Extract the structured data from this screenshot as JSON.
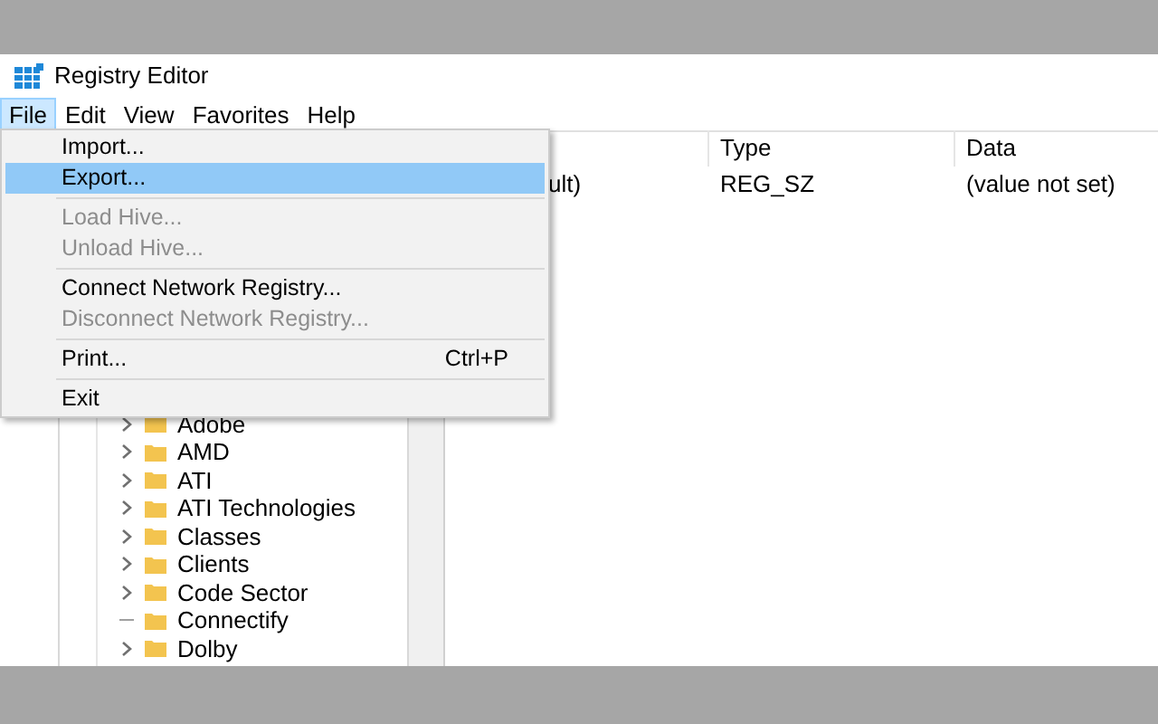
{
  "window": {
    "title": "Registry Editor"
  },
  "menu_bar": [
    {
      "label": "File",
      "selected": true
    },
    {
      "label": "Edit",
      "selected": false
    },
    {
      "label": "View",
      "selected": false
    },
    {
      "label": "Favorites",
      "selected": false
    },
    {
      "label": "Help",
      "selected": false
    }
  ],
  "file_menu": [
    {
      "kind": "item",
      "label": "Import...",
      "selected": false,
      "disabled": false
    },
    {
      "kind": "item",
      "label": "Export...",
      "selected": true,
      "disabled": false
    },
    {
      "kind": "separator"
    },
    {
      "kind": "item",
      "label": "Load Hive...",
      "selected": false,
      "disabled": true
    },
    {
      "kind": "item",
      "label": "Unload Hive...",
      "selected": false,
      "disabled": true
    },
    {
      "kind": "separator"
    },
    {
      "kind": "item",
      "label": "Connect Network Registry...",
      "selected": false,
      "disabled": false
    },
    {
      "kind": "item",
      "label": "Disconnect Network Registry...",
      "selected": false,
      "disabled": true
    },
    {
      "kind": "separator"
    },
    {
      "kind": "item",
      "label": "Print...",
      "shortcut": "Ctrl+P",
      "selected": false,
      "disabled": false
    },
    {
      "kind": "separator"
    },
    {
      "kind": "item",
      "label": "Exit",
      "selected": false,
      "disabled": false
    }
  ],
  "tree": [
    {
      "label": "Adobe",
      "expandable": true
    },
    {
      "label": "AMD",
      "expandable": true
    },
    {
      "label": "ATI",
      "expandable": true
    },
    {
      "label": "ATI Technologies",
      "expandable": true
    },
    {
      "label": "Classes",
      "expandable": true
    },
    {
      "label": "Clients",
      "expandable": true
    },
    {
      "label": "Code Sector",
      "expandable": true
    },
    {
      "label": "Connectify",
      "expandable": false
    },
    {
      "label": "Dolby",
      "expandable": true
    }
  ],
  "values_table": {
    "columns": [
      "",
      "Type",
      "Data"
    ],
    "rows": [
      [
        "ult)",
        "REG_SZ",
        "(value not set)"
      ]
    ]
  }
}
